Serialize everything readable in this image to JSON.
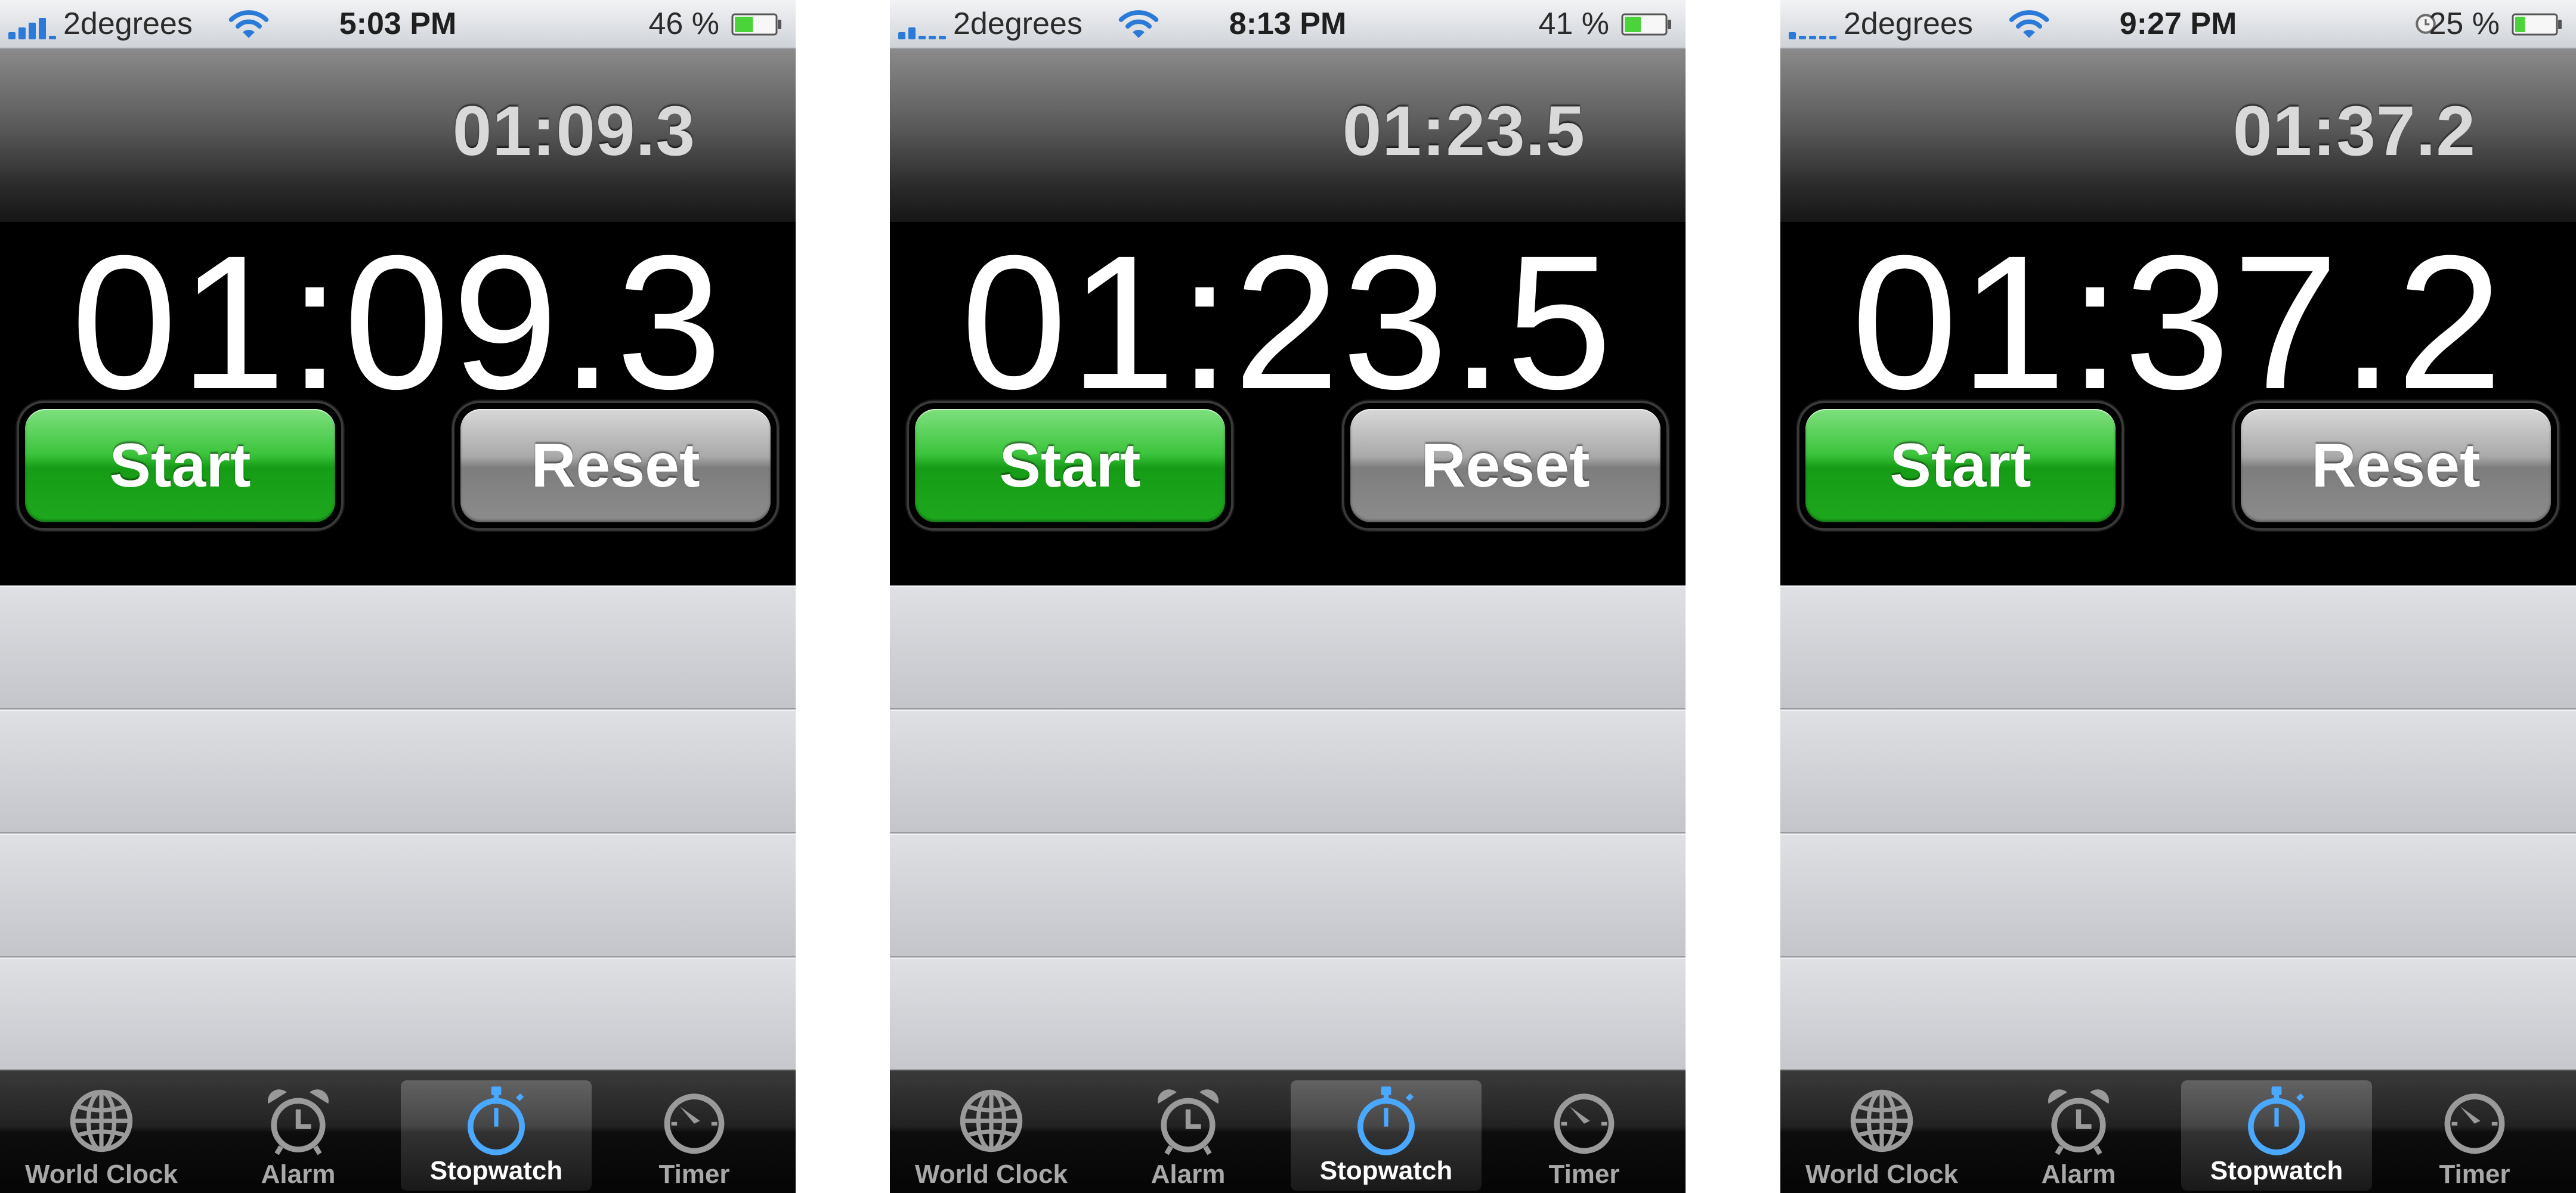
{
  "colors": {
    "start_green": "#1ea81e",
    "reset_gray": "#8c8c8c",
    "selected_tab_blue": "#4aa8ff",
    "signal_blue": "#2c7ad8",
    "battery_green": "#4bd33a"
  },
  "screens": [
    {
      "status": {
        "carrier": "2degrees",
        "time": "5:03 PM",
        "battery_pct": "46 %",
        "signal_bars": 4,
        "battery_level": 0.46,
        "alarm_icon": false
      },
      "lap_time": "01:09.3",
      "main_time": "01:09.3",
      "start_label": "Start",
      "reset_label": "Reset"
    },
    {
      "status": {
        "carrier": "2degrees",
        "time": "8:13 PM",
        "battery_pct": "41 %",
        "signal_bars": 2,
        "battery_level": 0.41,
        "alarm_icon": false
      },
      "lap_time": "01:23.5",
      "main_time": "01:23.5",
      "start_label": "Start",
      "reset_label": "Reset"
    },
    {
      "status": {
        "carrier": "2degrees",
        "time": "9:27 PM",
        "battery_pct": "25 %",
        "signal_bars": 1,
        "battery_level": 0.25,
        "alarm_icon": true
      },
      "lap_time": "01:37.2",
      "main_time": "01:37.2",
      "start_label": "Start",
      "reset_label": "Reset"
    }
  ],
  "tabs": [
    {
      "label": "World Clock",
      "icon": "globe-icon",
      "selected": false
    },
    {
      "label": "Alarm",
      "icon": "alarm-clock-icon",
      "selected": false
    },
    {
      "label": "Stopwatch",
      "icon": "stopwatch-icon",
      "selected": true
    },
    {
      "label": "Timer",
      "icon": "timer-icon",
      "selected": false
    }
  ]
}
